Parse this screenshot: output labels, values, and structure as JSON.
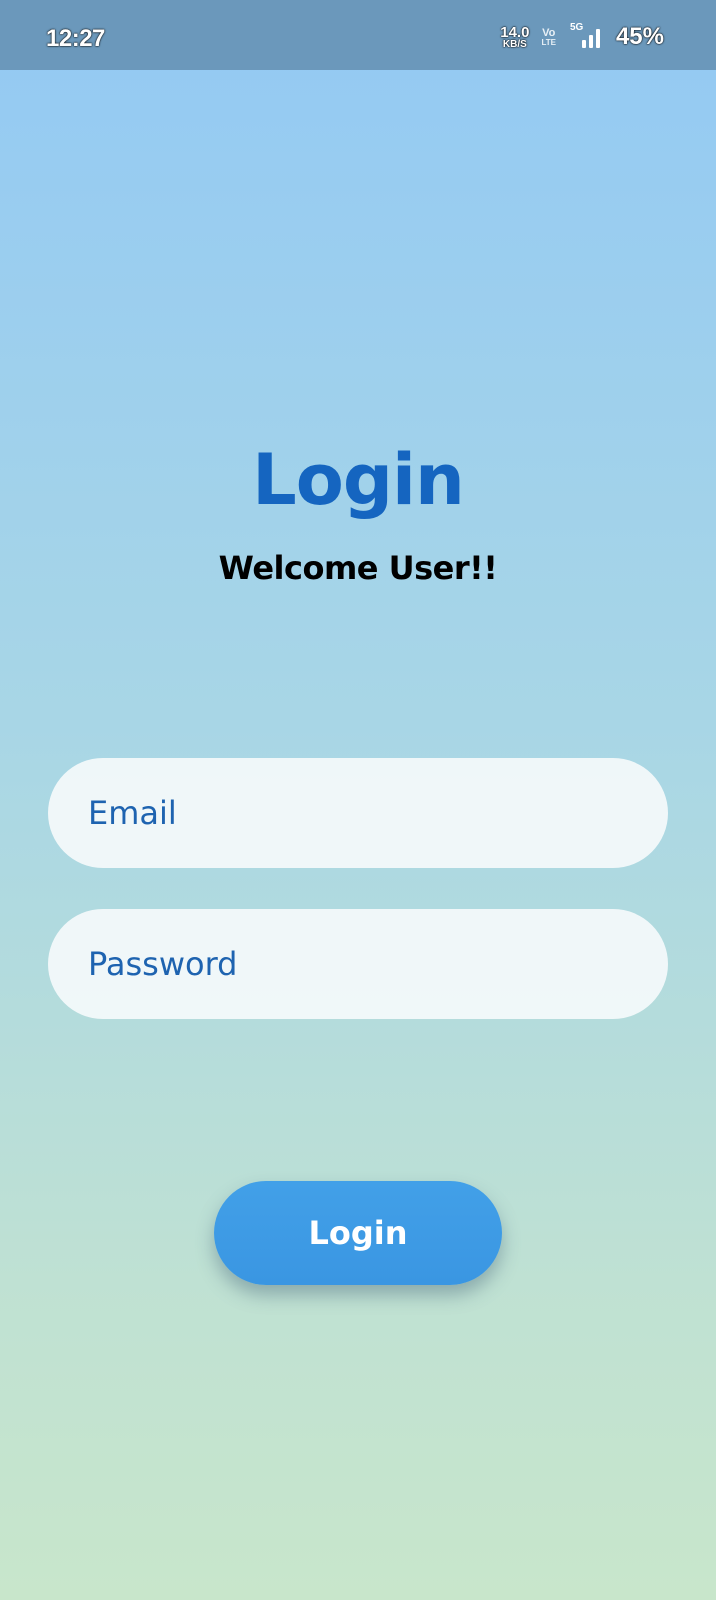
{
  "status_bar": {
    "time": "12:27",
    "net_speed_value": "14.0",
    "net_speed_unit": "KB/S",
    "volte_top": "Vo",
    "volte_bottom": "LTE",
    "network_type": "5G",
    "battery": "45%",
    "icons": [
      "volte-icon",
      "signal-icon"
    ]
  },
  "login": {
    "title": "Login",
    "subtitle": "Welcome User!!",
    "email_placeholder": "Email",
    "password_placeholder": "Password",
    "button_label": "Login"
  },
  "colors": {
    "title": "#1565c0",
    "placeholder": "#1e63b0",
    "button": "#3a96e2",
    "status_bar": "#6b98bb",
    "gradient_top": "#93c9f4",
    "gradient_bottom": "#c8e6cb"
  }
}
